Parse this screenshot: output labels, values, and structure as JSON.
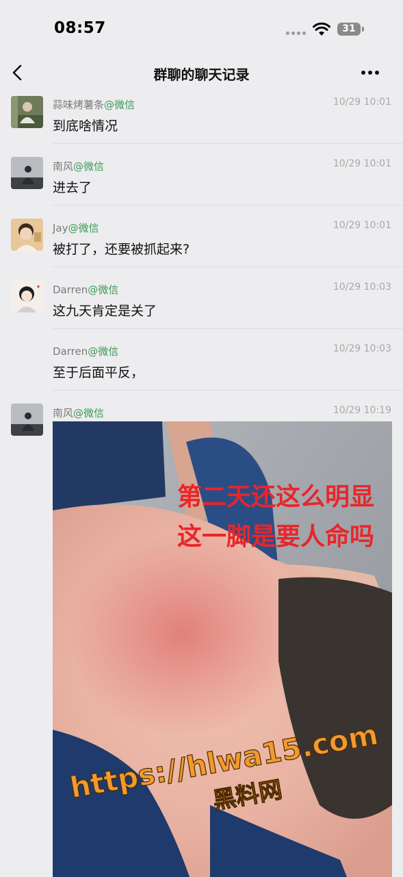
{
  "status": {
    "time": "08:57",
    "battery": "31"
  },
  "nav": {
    "title": "群聊的聊天记录"
  },
  "messages": [
    {
      "sender": "蒜味烤薯条",
      "source": "@微信",
      "time": "10/29 10:01",
      "text": "到底啥情况"
    },
    {
      "sender": "南风",
      "source": "@微信",
      "time": "10/29 10:01",
      "text": "进去了"
    },
    {
      "sender": "Jay",
      "source": "@微信",
      "time": "10/29 10:01",
      "text": "被打了，还要被抓起来?"
    },
    {
      "sender": "Darren",
      "source": "@微信",
      "time": "10/29 10:03",
      "text": "这九天肯定是关了"
    },
    {
      "sender": "Darren",
      "source": "@微信",
      "time": "10/29 10:03",
      "text": "至于后面平反，"
    },
    {
      "sender": "南风",
      "source": "@微信",
      "time": "10/29 10:19",
      "text": ""
    }
  ],
  "photo": {
    "overlay_line1": "第二天还这么明显",
    "overlay_line2": "这一脚是要人命吗",
    "watermark_url": "https://hlwa15.com",
    "watermark_name": "黑料网"
  },
  "icons": {
    "back": "chevron-left-icon",
    "more": "more-dots-icon",
    "wifi": "wifi-icon",
    "signal": "signal-icon",
    "battery": "battery-icon"
  },
  "colors": {
    "source_green": "#3b9a56",
    "overlay_red": "#e8262a",
    "watermark_orange": "#f29a2e"
  }
}
